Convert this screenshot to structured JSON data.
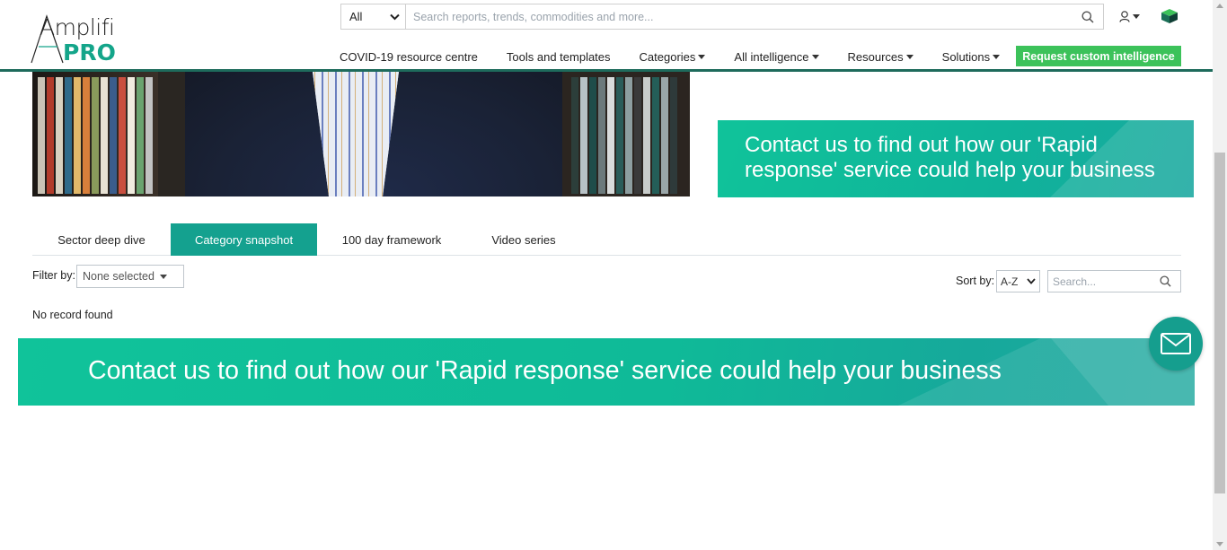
{
  "brand": {
    "name_part1": "Amplifi",
    "name_part2": "PRO",
    "accent": "#14a58a"
  },
  "search": {
    "scope": "All",
    "placeholder": "Search reports, trends, commodities and more..."
  },
  "nav": {
    "items": [
      {
        "label": "COVID-19 resource centre",
        "has_dropdown": false
      },
      {
        "label": "Tools and templates",
        "has_dropdown": false
      },
      {
        "label": "Categories",
        "has_dropdown": true
      },
      {
        "label": "All intelligence",
        "has_dropdown": true
      },
      {
        "label": "Resources",
        "has_dropdown": true
      },
      {
        "label": "Solutions",
        "has_dropdown": true
      }
    ],
    "cta": "Request custom intelligence",
    "cta_color": "#3cc25a"
  },
  "side_banner": {
    "text": "Contact us to find out how our 'Rapid response' service could help your business"
  },
  "tabs": [
    {
      "label": "Sector deep dive",
      "active": false
    },
    {
      "label": "Category snapshot",
      "active": true
    },
    {
      "label": "100 day framework",
      "active": false
    },
    {
      "label": "Video series",
      "active": false
    }
  ],
  "filter": {
    "label": "Filter by:",
    "value": "None selected"
  },
  "sort": {
    "label": "Sort by:",
    "value": "A-Z",
    "search_placeholder": "Search..."
  },
  "results": {
    "empty_message": "No record found"
  },
  "big_banner": {
    "text": "Contact us to find out how our 'Rapid response' service could help your business"
  },
  "icons": {
    "search": "search-icon",
    "user": "user-icon",
    "brand": "brand-cube-icon",
    "mail": "mail-icon"
  }
}
